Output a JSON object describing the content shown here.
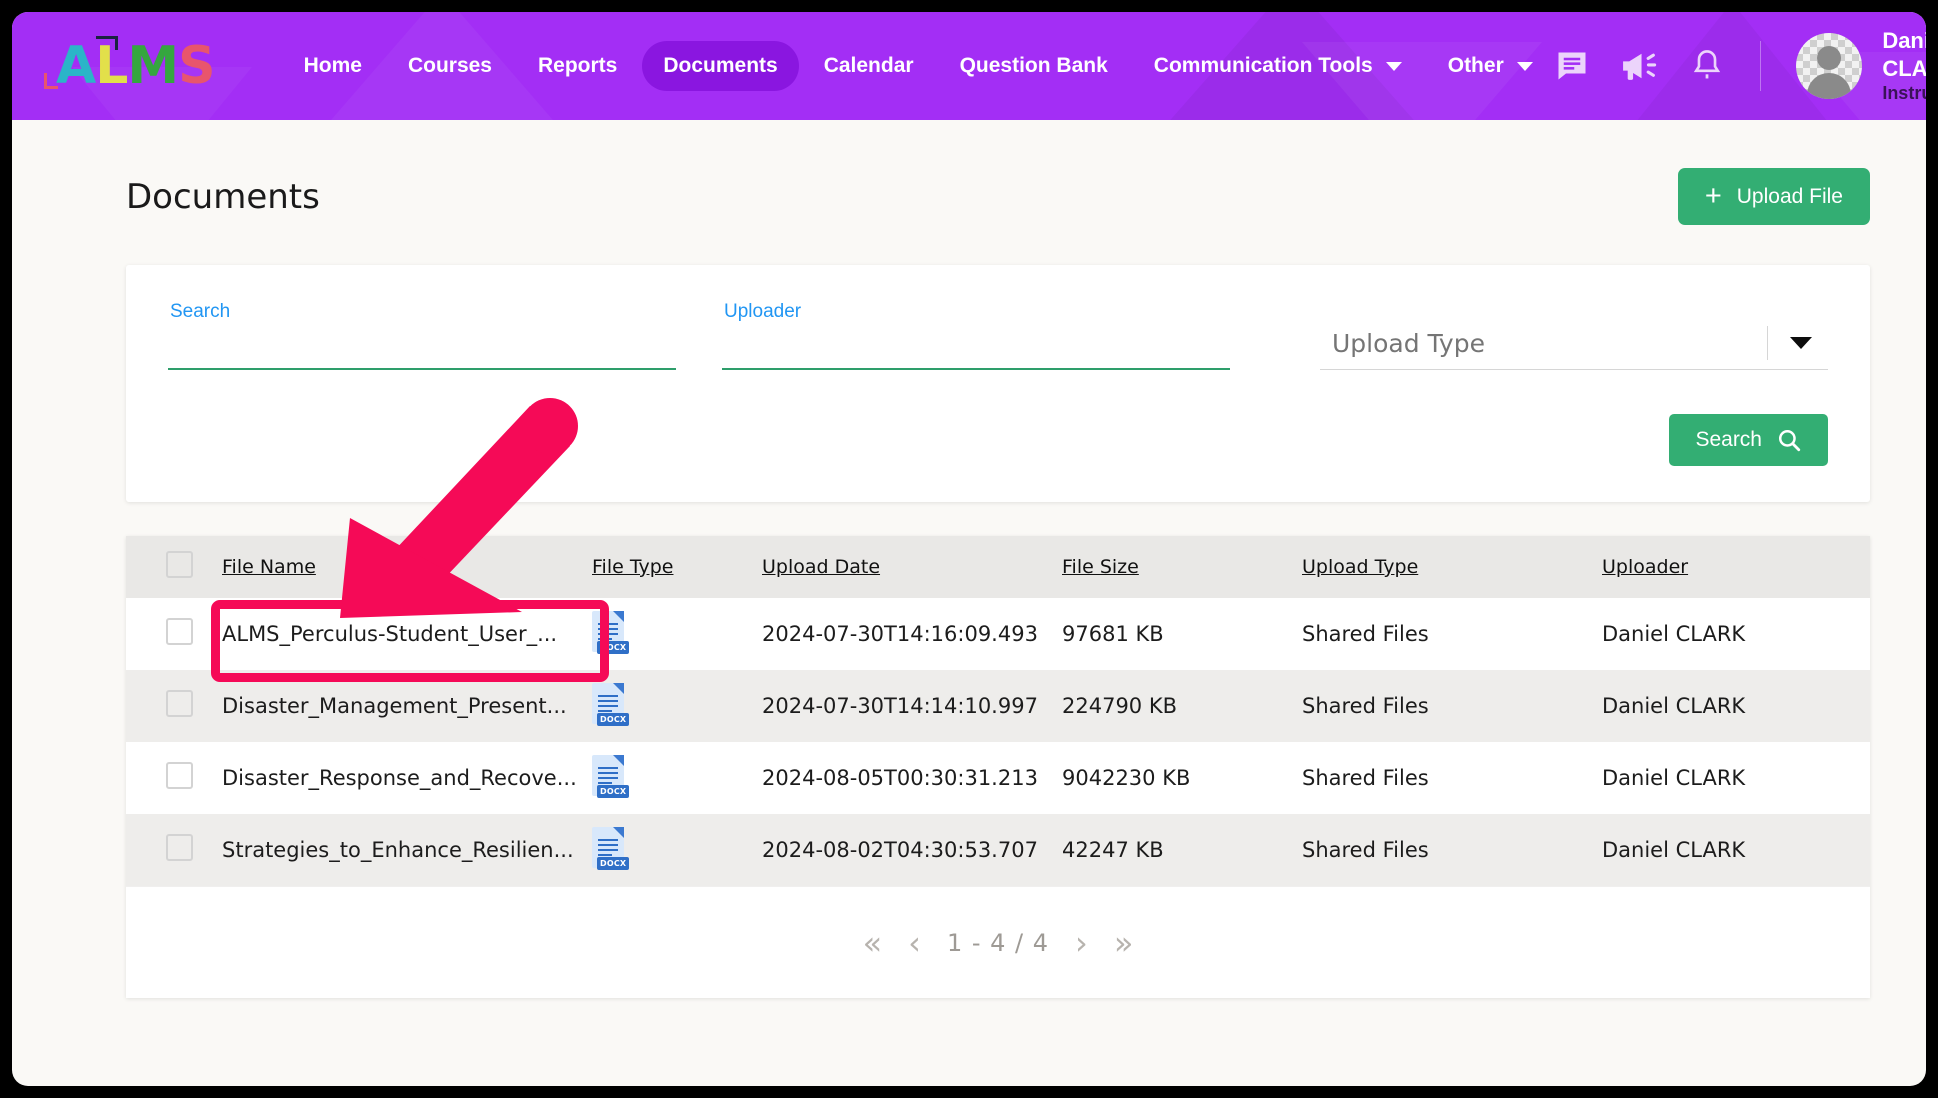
{
  "header": {
    "logo": {
      "letters": [
        "A",
        "L",
        "M",
        "S"
      ]
    },
    "nav": [
      {
        "label": "Home",
        "active": false,
        "dropdown": false
      },
      {
        "label": "Courses",
        "active": false,
        "dropdown": false
      },
      {
        "label": "Reports",
        "active": false,
        "dropdown": false
      },
      {
        "label": "Documents",
        "active": true,
        "dropdown": false
      },
      {
        "label": "Calendar",
        "active": false,
        "dropdown": false
      },
      {
        "label": "Question Bank",
        "active": false,
        "dropdown": false
      },
      {
        "label": "Communication Tools",
        "active": false,
        "dropdown": true
      },
      {
        "label": "Other",
        "active": false,
        "dropdown": true
      }
    ],
    "icons": [
      "message-icon",
      "announcement-icon",
      "notification-bell-icon"
    ],
    "user": {
      "name": "Daniel CLARK",
      "role": "Instructor"
    },
    "colors": {
      "bar": "#a32ef5",
      "active_pill": "#8a16e0"
    }
  },
  "page": {
    "title": "Documents",
    "upload_button": "Upload File"
  },
  "filters": {
    "search": {
      "label": "Search",
      "value": "",
      "placeholder": ""
    },
    "uploader": {
      "label": "Uploader",
      "value": "",
      "placeholder": ""
    },
    "upload_type": {
      "placeholder": "Upload Type",
      "value": ""
    },
    "search_button": "Search"
  },
  "table": {
    "columns": [
      "File Name",
      "File Type",
      "Upload Date",
      "File Size",
      "Upload Type",
      "Uploader"
    ],
    "rows": [
      {
        "file_name": "ALMS_Perculus-Student_User_...",
        "file_type": "DOCX",
        "upload_date": "2024-07-30T14:16:09.493",
        "file_size": "97681 KB",
        "upload_type": "Shared Files",
        "uploader": "Daniel CLARK"
      },
      {
        "file_name": "Disaster_Management_Present...",
        "file_type": "DOCX",
        "upload_date": "2024-07-30T14:14:10.997",
        "file_size": "224790 KB",
        "upload_type": "Shared Files",
        "uploader": "Daniel CLARK"
      },
      {
        "file_name": "Disaster_Response_and_Recove...",
        "file_type": "DOCX",
        "upload_date": "2024-08-05T00:30:31.213",
        "file_size": "9042230 KB",
        "upload_type": "Shared Files",
        "uploader": "Daniel CLARK"
      },
      {
        "file_name": "Strategies_to_Enhance_Resilien...",
        "file_type": "DOCX",
        "upload_date": "2024-08-02T04:30:53.707",
        "file_size": "42247 KB",
        "upload_type": "Shared Files",
        "uploader": "Daniel CLARK"
      }
    ]
  },
  "pagination": {
    "first": "«",
    "prev": "‹",
    "label": "1 - 4 / 4",
    "next": "›",
    "last": "»"
  },
  "annotation": {
    "arrow_color": "#f50a57",
    "highlight_color": "#f50a57",
    "target": "ALMS_Perculus-Student_User_..."
  },
  "accent_colors": {
    "green": "#33ae73",
    "blue_label": "#2196f3",
    "purple": "#a32ef5"
  }
}
